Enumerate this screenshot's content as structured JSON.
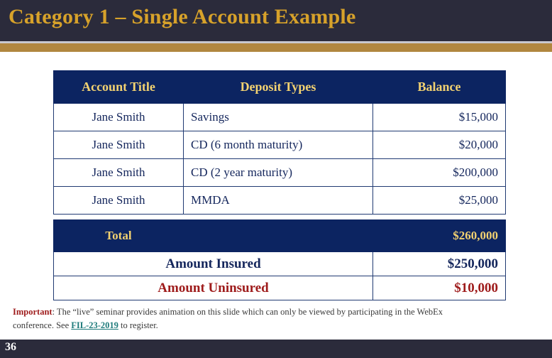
{
  "slide": {
    "title": "Category 1 – Single Account Example",
    "page_number": "36",
    "colors": {
      "title_band": "#2B2B3B",
      "title_text": "#D7A22A",
      "accent_bar": "#B1873F",
      "table_navy": "#0C2461",
      "table_gold_text": "#F3D271",
      "body_navy_text": "#14265C",
      "alert_red": "#9E1B1B",
      "link_teal": "#1E7B7B",
      "footer_bar": "#2B2B3B"
    }
  },
  "table": {
    "headers": {
      "account_title": "Account Title",
      "deposit_types": "Deposit Types",
      "balance": "Balance"
    },
    "rows": [
      {
        "account_title": "Jane Smith",
        "deposit_types": "Savings",
        "balance": "$15,000"
      },
      {
        "account_title": "Jane Smith",
        "deposit_types": "CD (6 month maturity)",
        "balance": "$20,000"
      },
      {
        "account_title": "Jane Smith",
        "deposit_types": "CD (2 year maturity)",
        "balance": "$200,000"
      },
      {
        "account_title": "Jane Smith",
        "deposit_types": "MMDA",
        "balance": "$25,000"
      }
    ],
    "total": {
      "label": "Total",
      "middle": "",
      "value": "$260,000"
    },
    "summary": [
      {
        "label": "Amount Insured",
        "value": "$250,000",
        "style": "navy"
      },
      {
        "label": "Amount Uninsured",
        "value": "$10,000",
        "style": "red"
      }
    ]
  },
  "footnote": {
    "important_label": "Important",
    "text_before_link": ": The “live” seminar provides animation on this slide which can only be viewed by participating in the WebEx conference. See ",
    "link_text": "FIL-23-2019",
    "text_after_link": " to register."
  }
}
